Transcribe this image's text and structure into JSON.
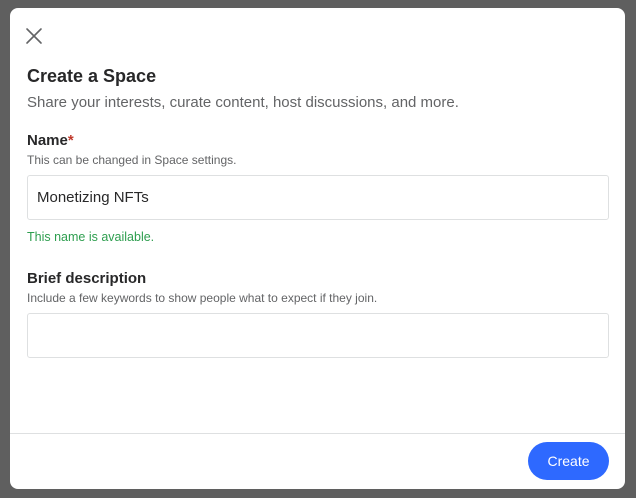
{
  "modal": {
    "title": "Create a Space",
    "subtitle": "Share your interests, curate content, host discussions, and more."
  },
  "name_field": {
    "label": "Name",
    "required_marker": "*",
    "help": "This can be changed in Space settings.",
    "value": "Monetizing NFTs",
    "status": "This name is available."
  },
  "description_field": {
    "label": "Brief description",
    "help": "Include a few keywords to show people what to expect if they join.",
    "value": ""
  },
  "footer": {
    "create_label": "Create"
  },
  "colors": {
    "accent": "#2e69ff",
    "success": "#2e9e4f",
    "required": "#c0392b"
  }
}
